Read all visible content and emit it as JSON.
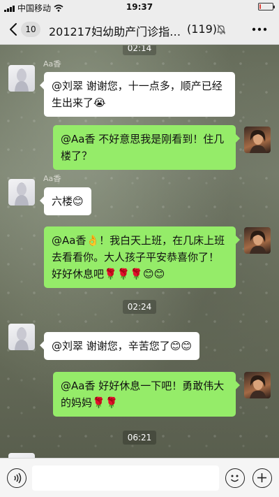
{
  "status_bar": {
    "carrier": "中国移动",
    "time": "19:37",
    "battery_level": 0.12,
    "battery_color": "#e0433a"
  },
  "nav": {
    "back_icon": "chevron-left-icon",
    "unread_count": "10",
    "title": "201217妇幼助产门诊指…",
    "member_count": "(119)",
    "mute_icon": "bell-off-icon",
    "more_icon": "ellipsis-icon"
  },
  "messages": {
    "top_partial_time": "02:14",
    "m1": {
      "sender": "Aa香",
      "text": "@刘翠 谢谢您，十一点多，顺产已经生出来了",
      "emoji": "😭"
    },
    "m2": {
      "text": "@Aa香 不好意思我是刚看到！住几楼了？"
    },
    "m3": {
      "sender": "Aa香",
      "text": "六楼",
      "emoji": "😊"
    },
    "m4": {
      "text_a": "@Aa香",
      "emoji_a": "👌",
      "text_b": "！我白天上班，在几床上班去看看你。大人孩子平安恭喜你了！好好休息吧",
      "emoji_b": "🌹🌹🌹😊😊"
    },
    "time_1": "02:24",
    "m5": {
      "text": "@刘翠 谢谢您，辛苦您了",
      "emoji": "😊😊"
    },
    "m6": {
      "text": "@Aa香 好好休息一下吧！勇敢伟大的妈妈",
      "emoji": "🌹🌹"
    },
    "time_2": "06:21"
  },
  "input_bar": {
    "voice_icon": "voice-icon",
    "emoji_icon": "smile-icon",
    "plus_icon": "plus-icon",
    "input_value": ""
  },
  "colors": {
    "outgoing_bubble": "#95ec69",
    "incoming_bubble": "#ffffff",
    "bar_background": "#ededed"
  }
}
